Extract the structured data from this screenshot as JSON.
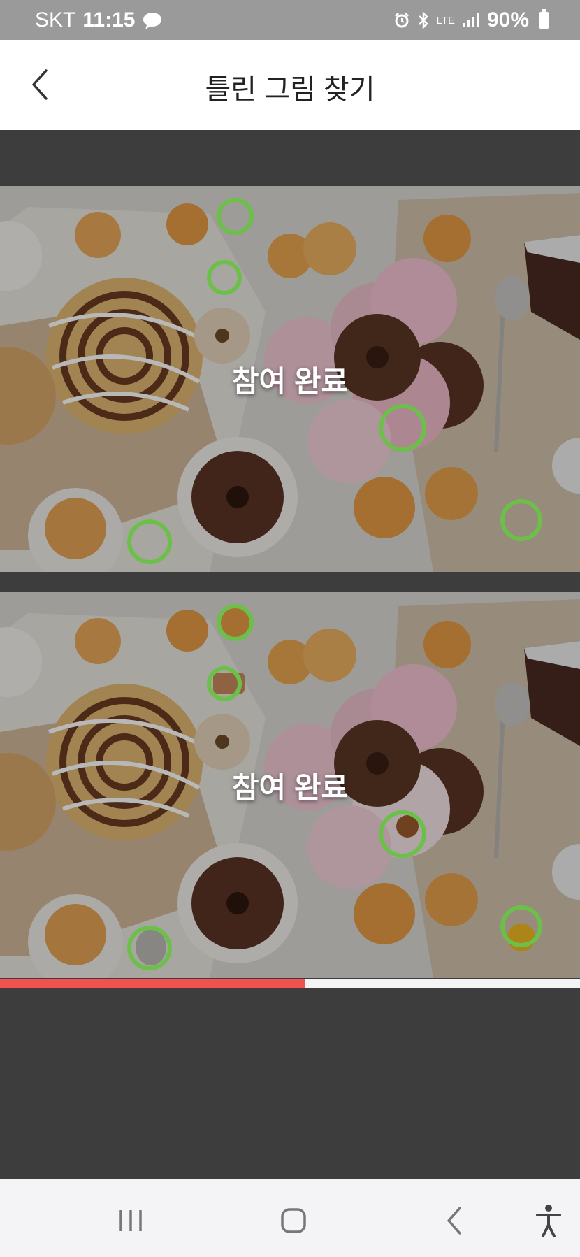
{
  "status_bar": {
    "carrier": "SKT",
    "time": "11:15",
    "network": "LTE",
    "battery": "90%"
  },
  "header": {
    "title": "틀린 그림 찾기"
  },
  "game": {
    "top_overlay": "참여 완료",
    "bottom_overlay": "참여 완료",
    "found_count": 5,
    "progress": 0.525,
    "marker_color": "#6cc04a",
    "progress_color": "#f0534f"
  },
  "icons": {
    "back": "chevron-left-icon",
    "recents": "recents-icon",
    "home": "home-icon",
    "nav_back": "back-icon",
    "accessibility": "accessibility-icon"
  }
}
